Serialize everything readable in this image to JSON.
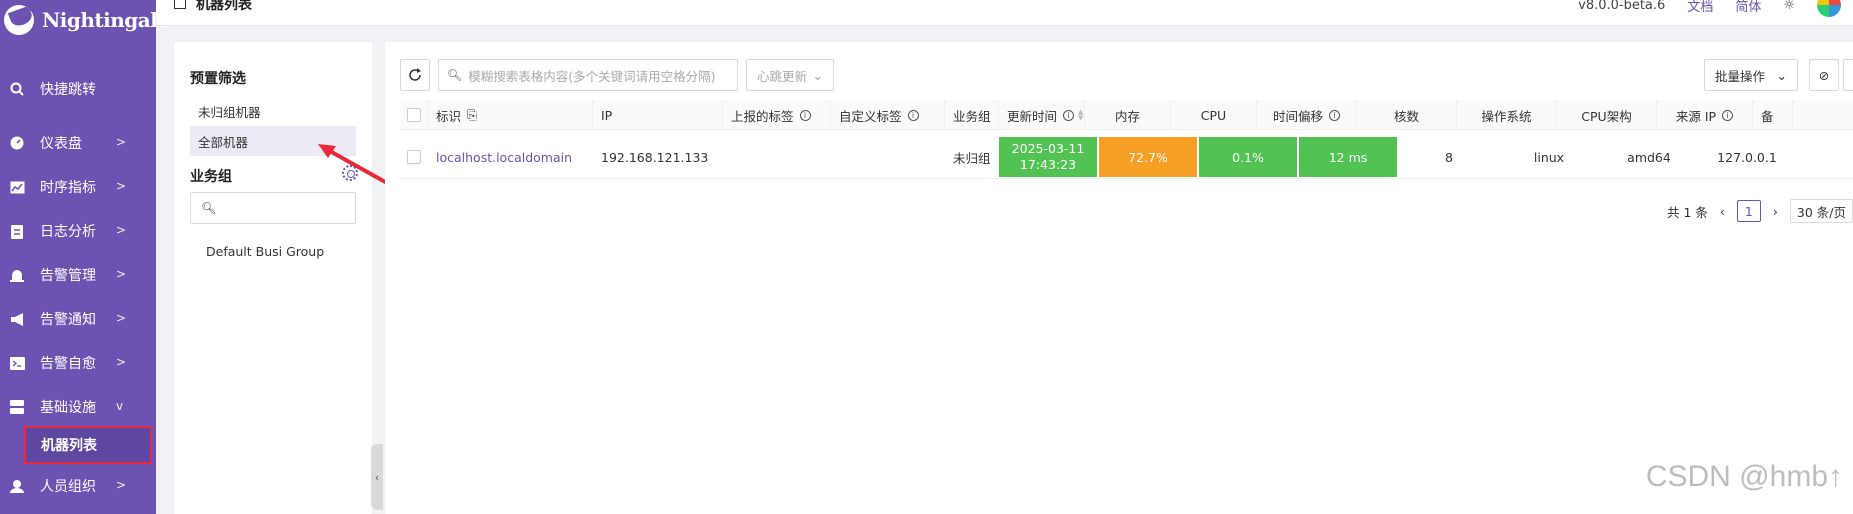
{
  "app": {
    "logo_text": "Nightingale"
  },
  "sidebar": {
    "items": [
      {
        "label": "快捷跳转",
        "icon": "search-icon",
        "chevron": ""
      },
      {
        "label": "仪表盘",
        "icon": "dashboard-icon",
        "chevron": ">"
      },
      {
        "label": "时序指标",
        "icon": "chart-icon",
        "chevron": ">"
      },
      {
        "label": "日志分析",
        "icon": "log-icon",
        "chevron": ">"
      },
      {
        "label": "告警管理",
        "icon": "alarm-icon",
        "chevron": ">"
      },
      {
        "label": "告警通知",
        "icon": "megaphone-icon",
        "chevron": ">"
      },
      {
        "label": "告警自愈",
        "icon": "terminal-icon",
        "chevron": ">"
      },
      {
        "label": "基础设施",
        "icon": "server-icon",
        "chevron": "v"
      },
      {
        "label": "人员组织",
        "icon": "user-icon",
        "chevron": ">"
      }
    ],
    "active_sub": "机器列表"
  },
  "header": {
    "title": "机器列表",
    "version": "v8.0.0-beta.6",
    "docs": "文档",
    "lang": "简体"
  },
  "filter": {
    "preset_title": "预置筛选",
    "preset_items": [
      "未归组机器",
      "全部机器"
    ],
    "group_title": "业务组",
    "group_search_placeholder": "",
    "groups": [
      "Default Busi Group"
    ]
  },
  "toolbar": {
    "search_placeholder": "模糊搜索表格内容(多个关键词请用空格分隔)",
    "heartbeat_select": "心跳更新",
    "batch_label": "批量操作"
  },
  "table": {
    "columns": [
      "标识",
      "IP",
      "上报的标签",
      "自定义标签",
      "业务组",
      "更新时间",
      "内存",
      "CPU",
      "时间偏移",
      "核数",
      "操作系统",
      "CPU架构",
      "来源 IP",
      "备"
    ],
    "rows": [
      {
        "ident": "localhost.localdomain",
        "ip": "192.168.121.133",
        "reported_tags": "",
        "custom_tags": "",
        "busi_group": "未归组",
        "update_date": "2025-03-11",
        "update_time": "17:43:23",
        "mem": "72.7%",
        "cpu": "0.1%",
        "offset": "12 ms",
        "cores": "8",
        "os": "linux",
        "arch": "amd64",
        "source_ip": "127.0.0.1"
      }
    ]
  },
  "pagination": {
    "total": "共 1 条",
    "current": "1",
    "page_size": "30 条/页"
  },
  "watermark": "CSDN @hmb↑",
  "colors": {
    "brand": "#6c53b1",
    "ok": "#52c352",
    "warn": "#f5a025",
    "highlight": "#e8293b"
  }
}
